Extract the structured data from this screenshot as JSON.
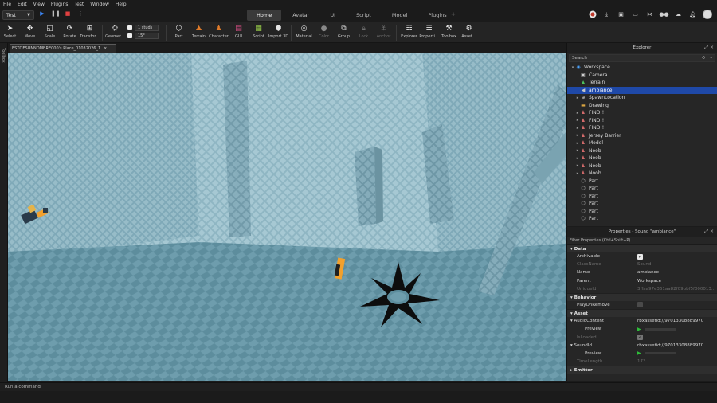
{
  "menu": [
    "File",
    "Edit",
    "View",
    "Plugins",
    "Test",
    "Window",
    "Help"
  ],
  "mode_select": {
    "value": "Test",
    "chevron": "chevron-down-icon"
  },
  "ribbon_tabs": [
    {
      "label": "Home",
      "active": true
    },
    {
      "label": "Avatar",
      "active": false
    },
    {
      "label": "UI",
      "active": false
    },
    {
      "label": "Script",
      "active": false
    },
    {
      "label": "Model",
      "active": false
    },
    {
      "label": "Plugins",
      "active": false
    }
  ],
  "tab_add": "+",
  "toolbar": {
    "select": "Select",
    "move": "Move",
    "scale": "Scale",
    "rotate": "Rotate",
    "transform": "Transfor...",
    "geometry": "Geomet...",
    "snap_move": "1 studs",
    "snap_rotate": "15°",
    "part": "Part",
    "terrain": "Terrain",
    "character": "Character",
    "gui": "GUI",
    "script": "Script",
    "import3d": "Import 3D",
    "material": "Material",
    "color": "Color",
    "group": "Group",
    "lock": "Lock",
    "anchor": "Anchor",
    "explorer": "Explorer",
    "properties": "Properti...",
    "toolbox": "Toolbox",
    "assets": "Asset..."
  },
  "left_strip": "Toolbox",
  "doc_tab": {
    "label": "ESTOESUNNOMBRE000's Place_01032026_1",
    "close": "×"
  },
  "explorer": {
    "title": "Explorer",
    "search_placeholder": "Search",
    "items": [
      {
        "label": "Workspace",
        "depth": 0,
        "expanded": true,
        "icon": "globe-icon",
        "color": "#4aa3ff"
      },
      {
        "label": "Camera",
        "depth": 1,
        "icon": "camera-icon",
        "color": "#cfcfcf"
      },
      {
        "label": "Terrain",
        "depth": 1,
        "icon": "terrain-icon",
        "color": "#4cc05a"
      },
      {
        "label": "ambiance",
        "depth": 1,
        "icon": "sound-icon",
        "color": "#c8c8c8",
        "selected": true
      },
      {
        "label": "SpawnLocation",
        "depth": 1,
        "arrow": true,
        "icon": "spawn-icon",
        "color": "#cfcfcf"
      },
      {
        "label": "Drawing",
        "depth": 1,
        "icon": "folder-icon",
        "color": "#d9a441"
      },
      {
        "label": "FIND!!!",
        "depth": 1,
        "arrow": true,
        "icon": "model-icon",
        "color": "#d46b6b"
      },
      {
        "label": "FIND!!!",
        "depth": 1,
        "arrow": true,
        "icon": "model-icon",
        "color": "#d46b6b"
      },
      {
        "label": "FIND!!!",
        "depth": 1,
        "arrow": true,
        "icon": "model-icon",
        "color": "#d46b6b"
      },
      {
        "label": "Jersey Barrier",
        "depth": 1,
        "arrow": true,
        "icon": "model-icon",
        "color": "#d46b6b"
      },
      {
        "label": "Model",
        "depth": 1,
        "arrow": true,
        "icon": "model-icon",
        "color": "#d46b6b"
      },
      {
        "label": "Noob",
        "depth": 1,
        "arrow": true,
        "icon": "model-icon",
        "color": "#d46b6b"
      },
      {
        "label": "Noob",
        "depth": 1,
        "arrow": true,
        "icon": "model-icon",
        "color": "#d46b6b"
      },
      {
        "label": "Noob",
        "depth": 1,
        "arrow": true,
        "icon": "model-icon",
        "color": "#d46b6b"
      },
      {
        "label": "Noob",
        "depth": 1,
        "arrow": true,
        "icon": "model-icon",
        "color": "#d46b6b"
      },
      {
        "label": "Part",
        "depth": 1,
        "icon": "part-icon",
        "color": "#cfcfcf"
      },
      {
        "label": "Part",
        "depth": 1,
        "icon": "part-icon",
        "color": "#cfcfcf"
      },
      {
        "label": "Part",
        "depth": 1,
        "icon": "part-icon",
        "color": "#cfcfcf"
      },
      {
        "label": "Part",
        "depth": 1,
        "icon": "part-icon",
        "color": "#cfcfcf"
      },
      {
        "label": "Part",
        "depth": 1,
        "icon": "part-icon",
        "color": "#cfcfcf"
      },
      {
        "label": "Part",
        "depth": 1,
        "icon": "part-icon",
        "color": "#cfcfcf"
      }
    ]
  },
  "properties": {
    "title": "Properties - Sound \"ambiance\"",
    "filter_placeholder": "Filter Properties (Ctrl+Shift+P)",
    "sections": [
      {
        "name": "Data",
        "rows": [
          {
            "name": "Archivable",
            "type": "check",
            "checked": true
          },
          {
            "name": "ClassName",
            "value": "Sound",
            "dim": true
          },
          {
            "name": "Name",
            "value": "ambiance"
          },
          {
            "name": "Parent",
            "value": "Workspace"
          },
          {
            "name": "UniqueId",
            "value": "3ffaa97e361aa82f09bbf5f000013...",
            "dim": true
          }
        ]
      },
      {
        "name": "Behavior",
        "rows": [
          {
            "name": "PlayOnRemove",
            "type": "check",
            "checked": false
          }
        ]
      },
      {
        "name": "Asset",
        "rows": [
          {
            "name": "AudioContent",
            "value": "rbxassetid://97013308889970",
            "expandable": true
          },
          {
            "name": "Preview",
            "type": "preview",
            "indent": true
          },
          {
            "name": "IsLoaded",
            "type": "check",
            "checked": true,
            "dim": true
          },
          {
            "name": "SoundId",
            "value": "rbxassetid://97013308889970",
            "expandable": true
          },
          {
            "name": "Preview",
            "type": "preview",
            "indent": true
          },
          {
            "name": "TimeLength",
            "value": "173",
            "dim": true
          }
        ]
      },
      {
        "name": "Emitter",
        "rows": []
      }
    ]
  },
  "command_bar": {
    "placeholder": "Run a command"
  }
}
